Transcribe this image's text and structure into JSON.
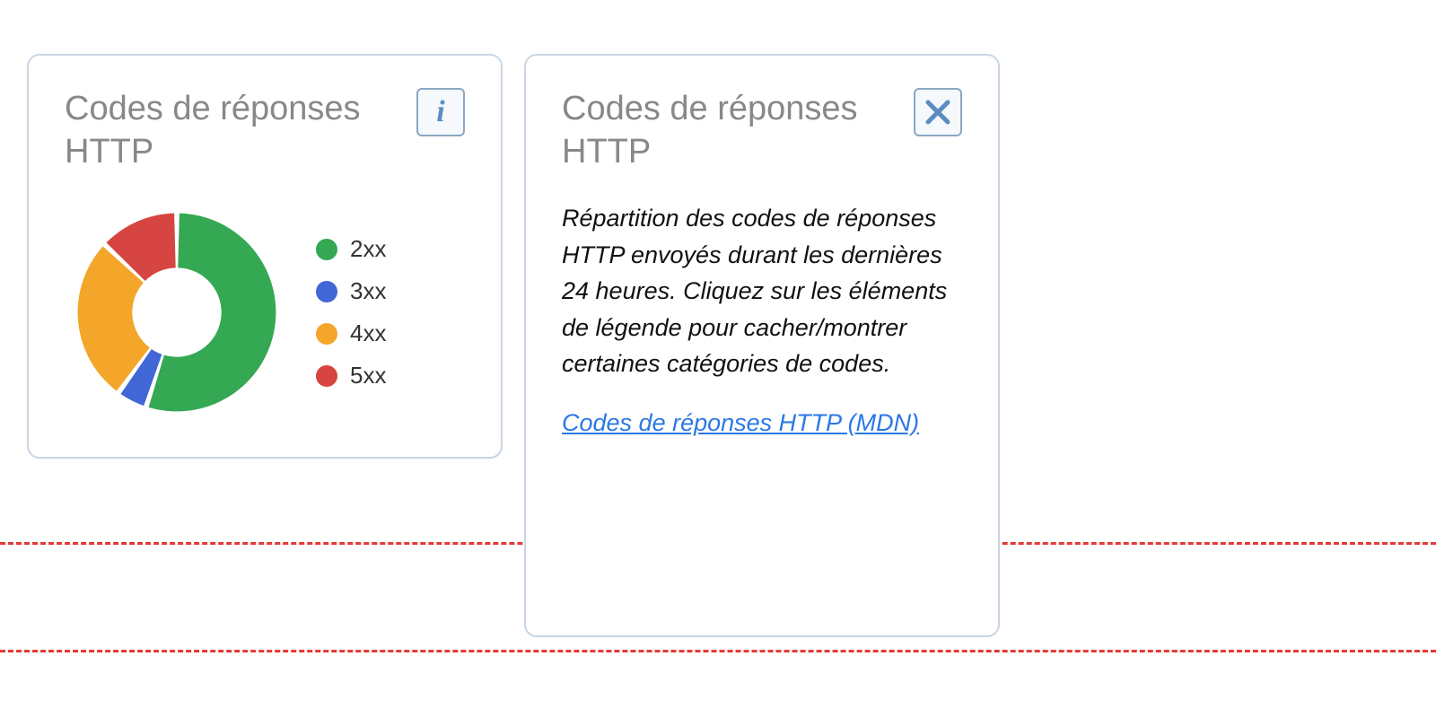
{
  "colors": {
    "c2xx": "#34a853",
    "c3xx": "#4166d5",
    "c4xx": "#f4a62a",
    "c5xx": "#d64541"
  },
  "card_chart": {
    "title": "Codes de réponses HTTP",
    "legend": {
      "c2xx": "2xx",
      "c3xx": "3xx",
      "c4xx": "4xx",
      "c5xx": "5xx"
    }
  },
  "card_info": {
    "title": "Codes de réponses HTTP",
    "body": "Répartition des codes de réponses HTTP envoyés durant les dernières 24 heures. Cliquez sur les éléments de légende pour cacher/montrer certaines catégories de codes.",
    "link_text": "Codes de réponses HTTP (MDN)"
  },
  "chart_data": {
    "type": "pie",
    "title": "Codes de réponses HTTP",
    "series": [
      {
        "name": "2xx",
        "value": 55,
        "color": "#34a853"
      },
      {
        "name": "3xx",
        "value": 5,
        "color": "#4166d5"
      },
      {
        "name": "4xx",
        "value": 27,
        "color": "#f4a62a"
      },
      {
        "name": "5xx",
        "value": 13,
        "color": "#d64541"
      }
    ],
    "donut": true,
    "inner_radius_ratio": 0.45,
    "legend_position": "right"
  }
}
